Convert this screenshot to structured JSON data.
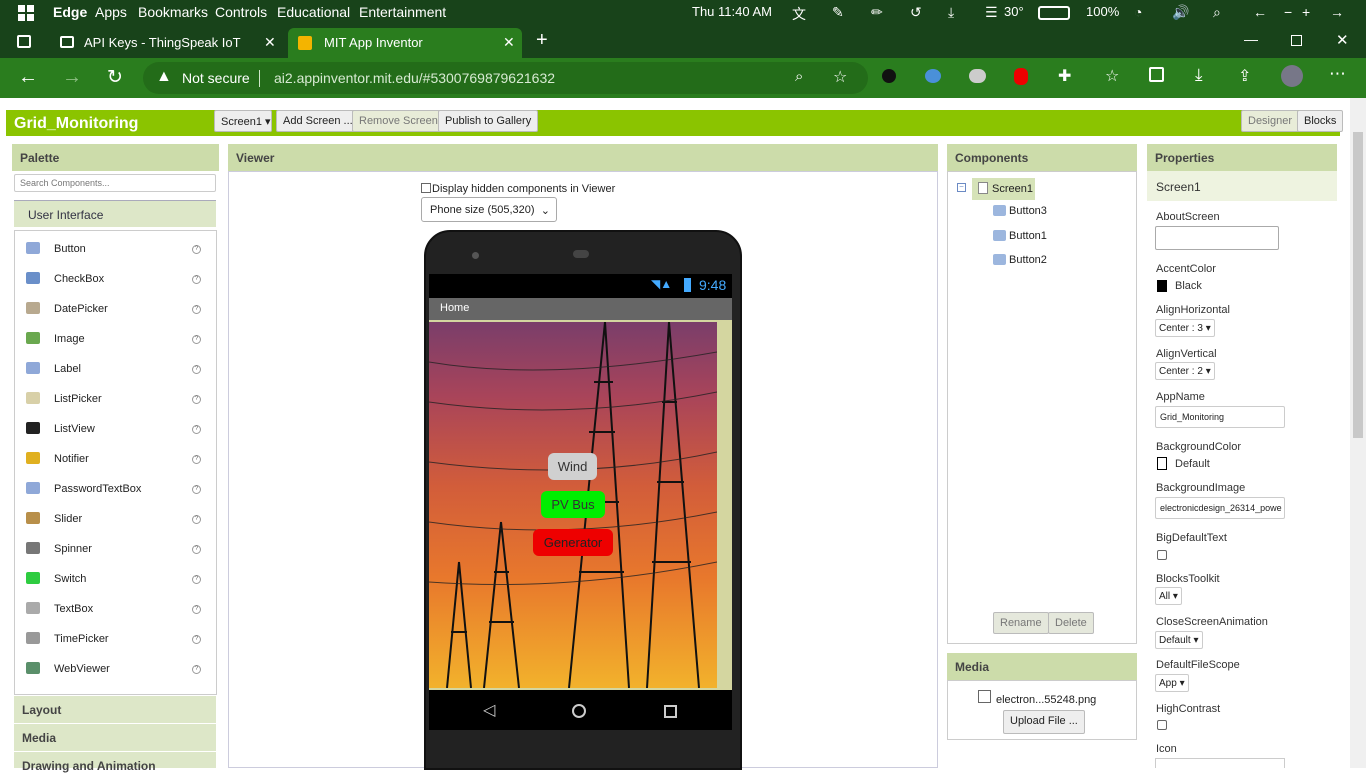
{
  "os": {
    "edge": "Edge",
    "menu": [
      "Apps",
      "Bookmarks",
      "Controls",
      "Educational",
      "Entertainment"
    ],
    "datetime": "Thu 11:40 AM",
    "temp": "30°",
    "battery": "100%"
  },
  "tabs": [
    {
      "label": "API Keys - ThingSpeak IoT"
    },
    {
      "label": "MIT App Inventor"
    }
  ],
  "address": {
    "secure_label": "Not secure",
    "url": "ai2.appinventor.mit.edu/#5300769879621632"
  },
  "app": {
    "project_name": "Grid_Monitoring",
    "screen_select": "Screen1",
    "add_screen": "Add Screen ...",
    "remove_screen": "Remove Screen",
    "publish": "Publish to Gallery",
    "designer": "Designer",
    "blocks": "Blocks"
  },
  "palette": {
    "title": "Palette",
    "search_placeholder": "Search Components...",
    "category": "User Interface",
    "items": [
      "Button",
      "CheckBox",
      "DatePicker",
      "Image",
      "Label",
      "ListPicker",
      "ListView",
      "Notifier",
      "PasswordTextBox",
      "Slider",
      "Spinner",
      "Switch",
      "TextBox",
      "TimePicker",
      "WebViewer"
    ],
    "categories_bottom": [
      "Layout",
      "Media",
      "Drawing and Animation"
    ]
  },
  "viewer": {
    "title": "Viewer",
    "hidden_label": "Display hidden components in Viewer",
    "size_select": "Phone size (505,320)",
    "phone_time": "9:48",
    "screen_title": "Home",
    "buttons": [
      "Wind",
      "PV Bus",
      "Generator"
    ]
  },
  "components": {
    "title": "Components",
    "root": "Screen1",
    "children": [
      "Button3",
      "Button1",
      "Button2"
    ],
    "rename": "Rename",
    "delete": "Delete"
  },
  "media": {
    "title": "Media",
    "file": "electron...55248.png",
    "upload": "Upload File ..."
  },
  "properties": {
    "title": "Properties",
    "screen": "Screen1",
    "about_label": "AboutScreen",
    "accent_label": "AccentColor",
    "accent_value": "Black",
    "alignh_label": "AlignHorizontal",
    "alignh_value": "Center : 3",
    "alignv_label": "AlignVertical",
    "alignv_value": "Center : 2",
    "appname_label": "AppName",
    "appname_value": "Grid_Monitoring",
    "bgcolor_label": "BackgroundColor",
    "bgcolor_value": "Default",
    "bgimage_label": "BackgroundImage",
    "bgimage_value": "electronicdesign_26314_powe",
    "bigtext_label": "BigDefaultText",
    "toolkit_label": "BlocksToolkit",
    "toolkit_value": "All",
    "close_anim_label": "CloseScreenAnimation",
    "close_anim_value": "Default",
    "filescope_label": "DefaultFileScope",
    "filescope_value": "App",
    "contrast_label": "HighContrast",
    "icon_label": "Icon"
  },
  "colors": {
    "green_header": "#8bc400",
    "panel_header": "#ccdcaa",
    "os_bar": "#18431a",
    "browser": "#2a7d1e",
    "wind": "#d0d0d0",
    "pv": "#00ee00",
    "gen": "#ee0000"
  }
}
